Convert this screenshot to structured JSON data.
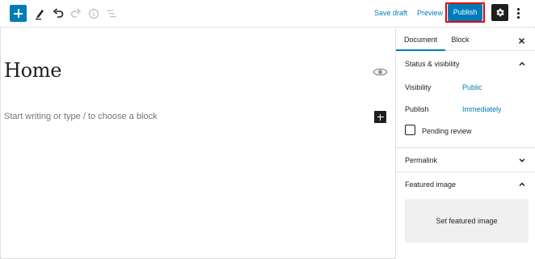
{
  "toolbar": {
    "add_block_icon": "plus-icon",
    "tools_icon": "pencil-icon",
    "undo_icon": "undo-icon",
    "redo_icon": "redo-icon",
    "info_icon": "info-icon",
    "outline_icon": "list-view-icon",
    "save_draft": "Save draft",
    "preview": "Preview",
    "publish": "Publish",
    "settings_icon": "gear-icon",
    "more_icon": "more-vertical-icon"
  },
  "editor": {
    "title": "Home",
    "block_placeholder": "Start writing or type / to choose a block",
    "visibility_icon": "eye-icon"
  },
  "sidebar": {
    "tabs": [
      {
        "label": "Document",
        "active": true
      },
      {
        "label": "Block",
        "active": false
      }
    ],
    "close_icon": "close-icon",
    "status": {
      "title": "Status & visibility",
      "expanded": true,
      "visibility_label": "Visibility",
      "visibility_value": "Public",
      "publish_label": "Publish",
      "publish_value": "Immediately",
      "pending_review_label": "Pending review",
      "pending_review_checked": false
    },
    "permalink": {
      "title": "Permalink",
      "expanded": false
    },
    "featured_image": {
      "title": "Featured image",
      "expanded": true,
      "button": "Set featured image"
    }
  },
  "colors": {
    "accent": "#007cba",
    "highlight_outline": "#e3000f",
    "dark": "#1e1e1e"
  }
}
